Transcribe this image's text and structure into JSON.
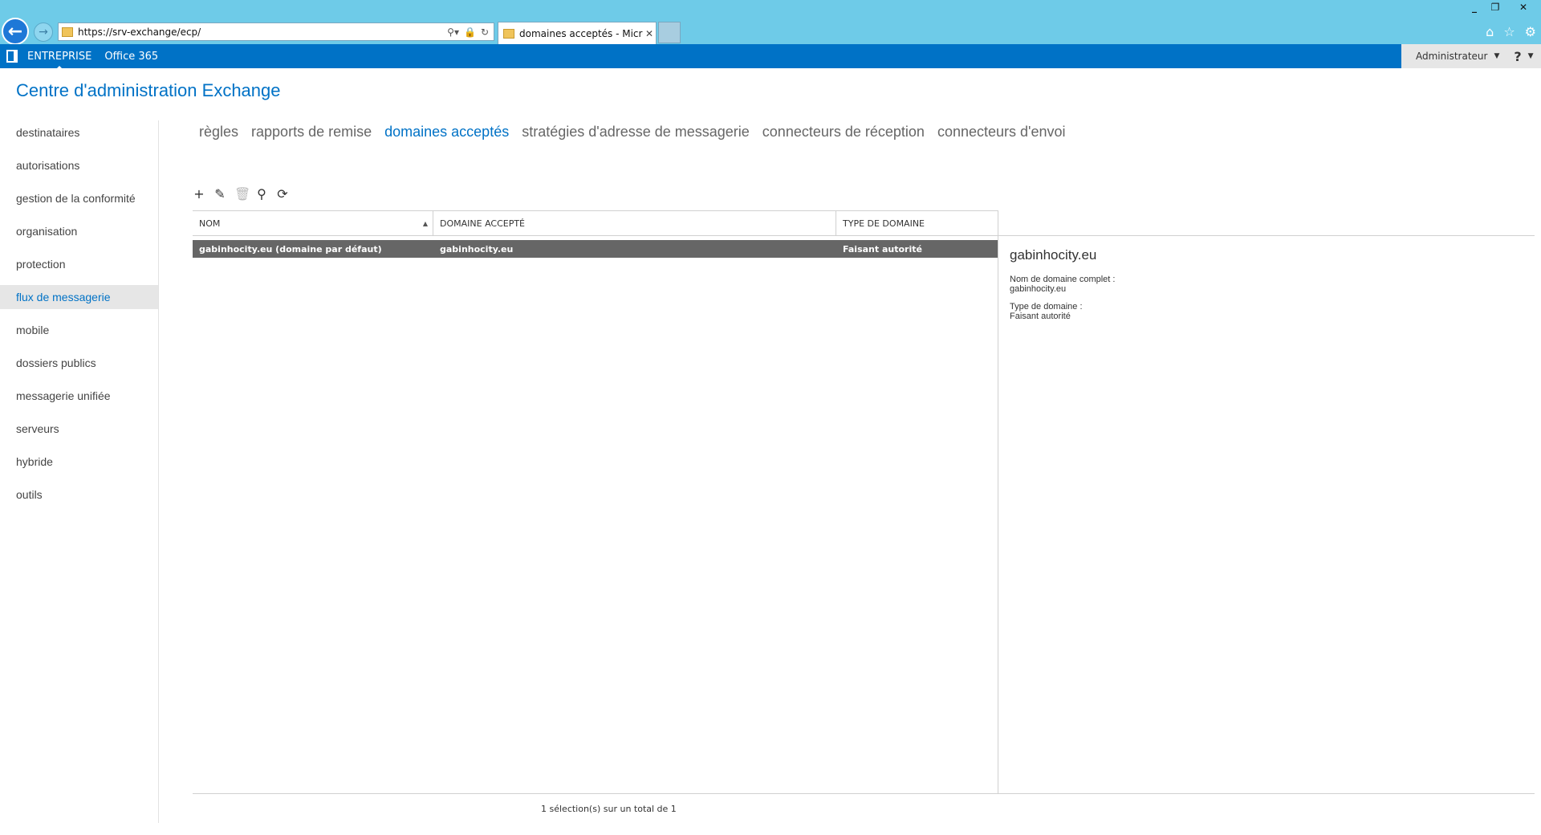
{
  "browser": {
    "window_buttons": [
      "minimize-icon",
      "restore-icon",
      "close-icon"
    ],
    "url": "https://srv-exchange/ecp/",
    "tab_title": "domaines acceptés - Micro...",
    "icons": [
      "home-icon",
      "star-icon",
      "gear-icon"
    ]
  },
  "office_bar": {
    "items": [
      "ENTREPRISE",
      "Office 365"
    ],
    "user": "Administrateur",
    "help": "?"
  },
  "app": {
    "title": "Centre d'administration Exchange"
  },
  "left_nav": {
    "items": [
      "destinataires",
      "autorisations",
      "gestion de la conformité",
      "organisation",
      "protection",
      "flux de messagerie",
      "mobile",
      "dossiers publics",
      "messagerie unifiée",
      "serveurs",
      "hybride",
      "outils"
    ],
    "active_index": 5
  },
  "sub_tabs": {
    "items": [
      "règles",
      "rapports de remise",
      "domaines acceptés",
      "stratégies d'adresse de messagerie",
      "connecteurs de réception",
      "connecteurs d'envoi"
    ],
    "active_index": 2
  },
  "toolbar": {
    "add": "+",
    "edit": "✎",
    "delete": "🗑",
    "search": "⚲",
    "refresh": "⟳"
  },
  "table": {
    "columns": [
      "NOM",
      "DOMAINE ACCEPTÉ",
      "TYPE DE DOMAINE"
    ],
    "rows": [
      {
        "nom": "gabinhocity.eu (domaine par défaut)",
        "domaine": "gabinhocity.eu",
        "type": "Faisant autorité"
      }
    ]
  },
  "details": {
    "title": "gabinhocity.eu",
    "fqdn_label": "Nom de domaine complet :",
    "fqdn_value": "gabinhocity.eu",
    "type_label": "Type de domaine :",
    "type_value": "Faisant autorité"
  },
  "footer": {
    "status": "1 sélection(s) sur un total de 1"
  }
}
